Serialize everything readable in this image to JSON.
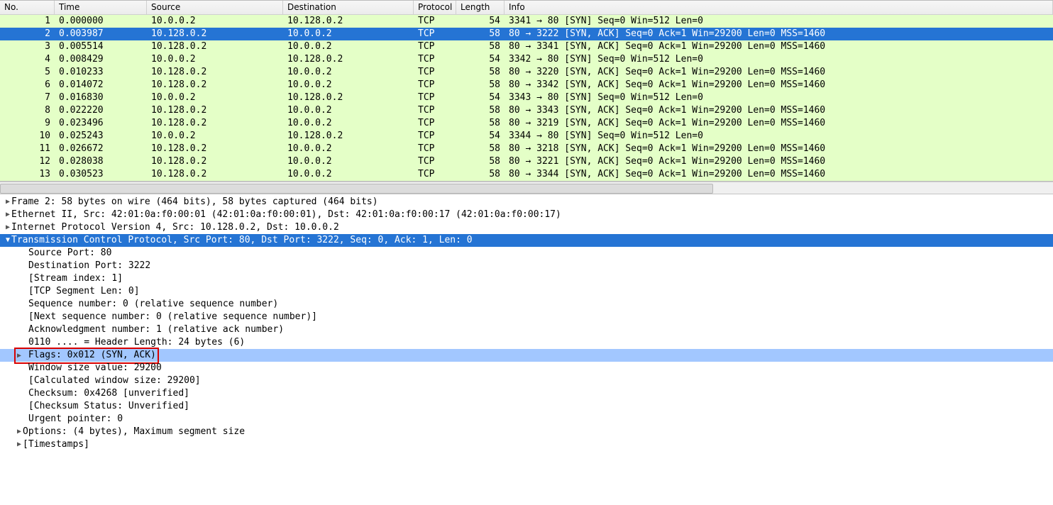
{
  "columns": {
    "no": "No.",
    "time": "Time",
    "src": "Source",
    "dst": "Destination",
    "prot": "Protocol",
    "len": "Length",
    "info": "Info"
  },
  "packets": [
    {
      "no": "1",
      "time": "0.000000",
      "src": "10.0.0.2",
      "dst": "10.128.0.2",
      "prot": "TCP",
      "len": "54",
      "info": "3341 → 80 [SYN] Seq=0 Win=512 Len=0",
      "sel": false
    },
    {
      "no": "2",
      "time": "0.003987",
      "src": "10.128.0.2",
      "dst": "10.0.0.2",
      "prot": "TCP",
      "len": "58",
      "info": "80 → 3222 [SYN, ACK] Seq=0 Ack=1 Win=29200 Len=0 MSS=1460",
      "sel": true
    },
    {
      "no": "3",
      "time": "0.005514",
      "src": "10.128.0.2",
      "dst": "10.0.0.2",
      "prot": "TCP",
      "len": "58",
      "info": "80 → 3341 [SYN, ACK] Seq=0 Ack=1 Win=29200 Len=0 MSS=1460",
      "sel": false
    },
    {
      "no": "4",
      "time": "0.008429",
      "src": "10.0.0.2",
      "dst": "10.128.0.2",
      "prot": "TCP",
      "len": "54",
      "info": "3342 → 80 [SYN] Seq=0 Win=512 Len=0",
      "sel": false
    },
    {
      "no": "5",
      "time": "0.010233",
      "src": "10.128.0.2",
      "dst": "10.0.0.2",
      "prot": "TCP",
      "len": "58",
      "info": "80 → 3220 [SYN, ACK] Seq=0 Ack=1 Win=29200 Len=0 MSS=1460",
      "sel": false
    },
    {
      "no": "6",
      "time": "0.014072",
      "src": "10.128.0.2",
      "dst": "10.0.0.2",
      "prot": "TCP",
      "len": "58",
      "info": "80 → 3342 [SYN, ACK] Seq=0 Ack=1 Win=29200 Len=0 MSS=1460",
      "sel": false
    },
    {
      "no": "7",
      "time": "0.016830",
      "src": "10.0.0.2",
      "dst": "10.128.0.2",
      "prot": "TCP",
      "len": "54",
      "info": "3343 → 80 [SYN] Seq=0 Win=512 Len=0",
      "sel": false
    },
    {
      "no": "8",
      "time": "0.022220",
      "src": "10.128.0.2",
      "dst": "10.0.0.2",
      "prot": "TCP",
      "len": "58",
      "info": "80 → 3343 [SYN, ACK] Seq=0 Ack=1 Win=29200 Len=0 MSS=1460",
      "sel": false
    },
    {
      "no": "9",
      "time": "0.023496",
      "src": "10.128.0.2",
      "dst": "10.0.0.2",
      "prot": "TCP",
      "len": "58",
      "info": "80 → 3219 [SYN, ACK] Seq=0 Ack=1 Win=29200 Len=0 MSS=1460",
      "sel": false
    },
    {
      "no": "10",
      "time": "0.025243",
      "src": "10.0.0.2",
      "dst": "10.128.0.2",
      "prot": "TCP",
      "len": "54",
      "info": "3344 → 80 [SYN] Seq=0 Win=512 Len=0",
      "sel": false
    },
    {
      "no": "11",
      "time": "0.026672",
      "src": "10.128.0.2",
      "dst": "10.0.0.2",
      "prot": "TCP",
      "len": "58",
      "info": "80 → 3218 [SYN, ACK] Seq=0 Ack=1 Win=29200 Len=0 MSS=1460",
      "sel": false
    },
    {
      "no": "12",
      "time": "0.028038",
      "src": "10.128.0.2",
      "dst": "10.0.0.2",
      "prot": "TCP",
      "len": "58",
      "info": "80 → 3221 [SYN, ACK] Seq=0 Ack=1 Win=29200 Len=0 MSS=1460",
      "sel": false
    },
    {
      "no": "13",
      "time": "0.030523",
      "src": "10.128.0.2",
      "dst": "10.0.0.2",
      "prot": "TCP",
      "len": "58",
      "info": "80 → 3344 [SYN, ACK] Seq=0 Ack=1 Win=29200 Len=0 MSS=1460",
      "sel": false
    }
  ],
  "details": {
    "frame": "Frame 2: 58 bytes on wire (464 bits), 58 bytes captured (464 bits)",
    "eth": "Ethernet II, Src: 42:01:0a:f0:00:01 (42:01:0a:f0:00:01), Dst: 42:01:0a:f0:00:17 (42:01:0a:f0:00:17)",
    "ip": "Internet Protocol Version 4, Src: 10.128.0.2, Dst: 10.0.0.2",
    "tcp": "Transmission Control Protocol, Src Port: 80, Dst Port: 3222, Seq: 0, Ack: 1, Len: 0",
    "srcport": "Source Port: 80",
    "dstport": "Destination Port: 3222",
    "stream": "[Stream index: 1]",
    "seglen": "[TCP Segment Len: 0]",
    "seq": "Sequence number: 0    (relative sequence number)",
    "nextseq": "[Next sequence number: 0    (relative sequence number)]",
    "ack": "Acknowledgment number: 1    (relative ack number)",
    "hdrlen": "0110 .... = Header Length: 24 bytes (6)",
    "flags": "Flags: 0x012 (SYN, ACK)",
    "win": "Window size value: 29200",
    "calcwin": "[Calculated window size: 29200]",
    "chksum": "Checksum: 0x4268 [unverified]",
    "chkstat": "[Checksum Status: Unverified]",
    "urgent": "Urgent pointer: 0",
    "options": "Options: (4 bytes), Maximum segment size",
    "ts": "[Timestamps]"
  }
}
